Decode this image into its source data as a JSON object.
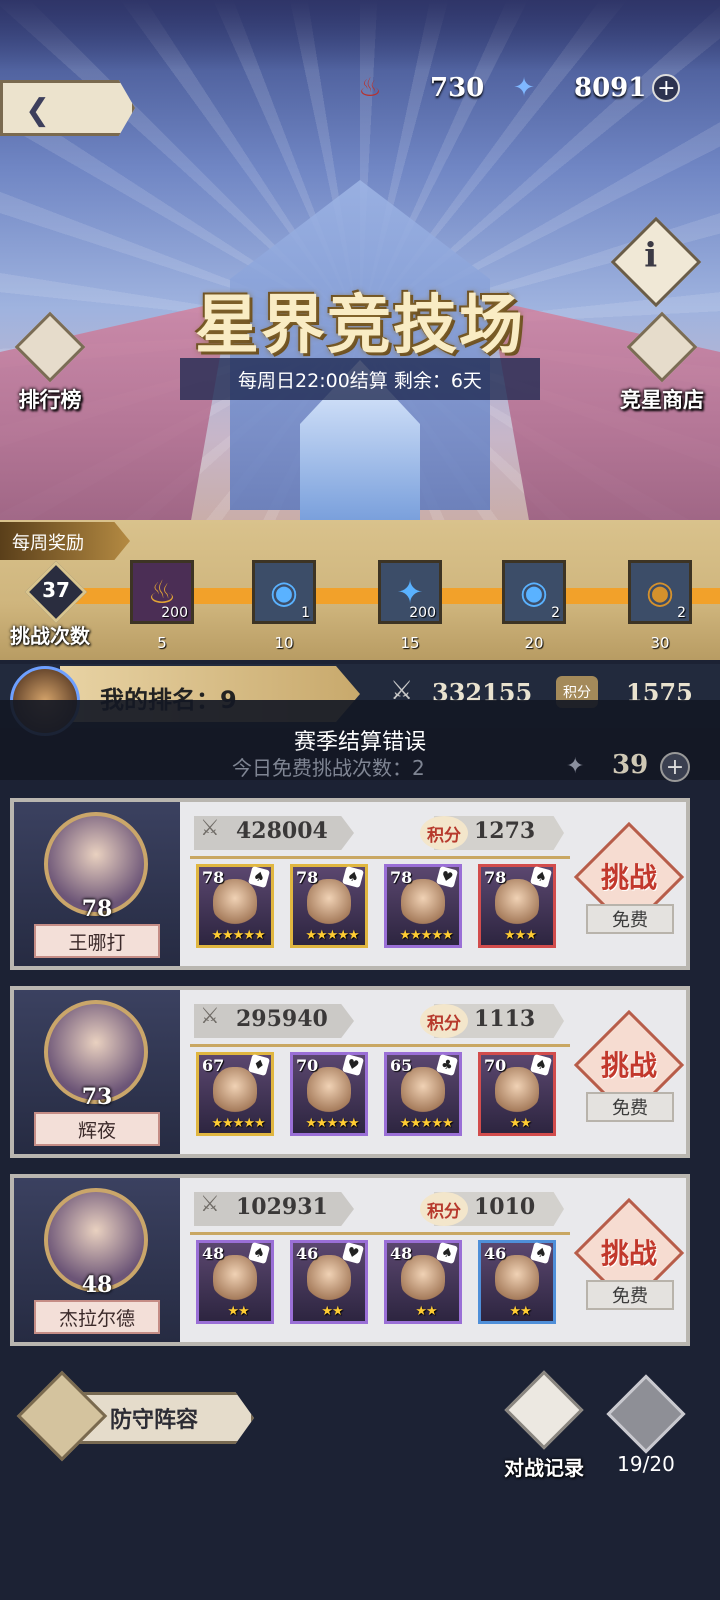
{
  "header": {
    "currencies": [
      {
        "icon": "dragon-coin-icon",
        "value": "730"
      },
      {
        "icon": "star-crystal-icon",
        "value": "8091"
      }
    ]
  },
  "arena": {
    "title": "星界竞技场",
    "settlement": "每周日22:00结算 剩余：6天",
    "rank_label": "排行榜",
    "shop_label": "竞星商店"
  },
  "weekly": {
    "tag": "每周奖励",
    "challenge_count": "37",
    "challenge_label": "挑战次数",
    "rewards": [
      {
        "icon": "dragon-coin-icon",
        "qty": "200",
        "milestone": "5"
      },
      {
        "icon": "blue-orb-icon",
        "qty": "1",
        "milestone": "10"
      },
      {
        "icon": "star-crystal-icon",
        "qty": "200",
        "milestone": "15"
      },
      {
        "icon": "blue-orb-icon",
        "qty": "2",
        "milestone": "20"
      },
      {
        "icon": "amber-orb-icon",
        "qty": "2",
        "milestone": "30"
      }
    ]
  },
  "my_rank": {
    "label": "我的排名：9",
    "power": "332155",
    "score_tag": "积分",
    "score": "1575"
  },
  "error": {
    "message": "赛季结算错误",
    "free_count": "今日免费挑战次数：2",
    "tickets": "39"
  },
  "opponents": [
    {
      "name": "王哪打",
      "level": "78",
      "power": "428004",
      "score_tag": "积分",
      "score": "1273",
      "challenge": "挑战",
      "cost": "免费",
      "heroes": [
        {
          "level": "78",
          "suit": "♠",
          "stars": "★★★★★"
        },
        {
          "level": "78",
          "suit": "♠",
          "stars": "★★★★★"
        },
        {
          "level": "78",
          "suit": "♥",
          "stars": "★★★★★"
        },
        {
          "level": "78",
          "suit": "♠",
          "stars": "★★★"
        }
      ]
    },
    {
      "name": "辉夜",
      "level": "73",
      "power": "295940",
      "score_tag": "积分",
      "score": "1113",
      "challenge": "挑战",
      "cost": "免费",
      "heroes": [
        {
          "level": "67",
          "suit": "♦",
          "stars": "★★★★★"
        },
        {
          "level": "70",
          "suit": "♥",
          "stars": "★★★★★"
        },
        {
          "level": "65",
          "suit": "♣",
          "stars": "★★★★★"
        },
        {
          "level": "70",
          "suit": "♠",
          "stars": "★★"
        }
      ]
    },
    {
      "name": "杰拉尔德",
      "level": "48",
      "power": "102931",
      "score_tag": "积分",
      "score": "1010",
      "challenge": "挑战",
      "cost": "免费",
      "heroes": [
        {
          "level": "48",
          "suit": "♠",
          "stars": "★★"
        },
        {
          "level": "46",
          "suit": "♥",
          "stars": "★★"
        },
        {
          "level": "48",
          "suit": "♠",
          "stars": "★★"
        },
        {
          "level": "46",
          "suit": "♠",
          "stars": "★★"
        }
      ]
    }
  ],
  "footer": {
    "defense_label": "防守阵容",
    "record_label": "对战记录",
    "refresh_count": "19/20"
  }
}
